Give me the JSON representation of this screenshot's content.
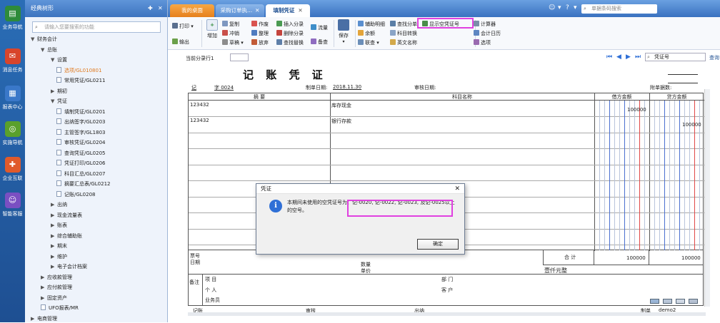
{
  "leftbar": {
    "items": [
      {
        "label": "业务导航",
        "color": "#2e8b3a"
      },
      {
        "label": "消息任务",
        "color": "#d8452b"
      },
      {
        "label": "报表中心",
        "color": "#3a78c9"
      },
      {
        "label": "实施导航",
        "color": "#5aa02c"
      },
      {
        "label": "企业互联",
        "color": "#e05a2b"
      },
      {
        "label": "智能客服",
        "color": "#7a4fc2"
      }
    ]
  },
  "sidebar": {
    "title": "经典树形",
    "search_placeholder": "请输入您要搜索的功能",
    "tree": [
      {
        "label": "财务会计",
        "level": 0,
        "arrow": "▼"
      },
      {
        "label": "总账",
        "level": 1,
        "arrow": "▼"
      },
      {
        "label": "设置",
        "level": 2,
        "arrow": "▼"
      },
      {
        "label": "选项/GL010801",
        "level": 3,
        "doc": true,
        "selected": true
      },
      {
        "label": "常用凭证/GL0211",
        "level": 3,
        "doc": true
      },
      {
        "label": "期初",
        "level": 2,
        "arrow": "▶"
      },
      {
        "label": "凭证",
        "level": 2,
        "arrow": "▼"
      },
      {
        "label": "填制凭证/GL0201",
        "level": 3,
        "doc": true
      },
      {
        "label": "出纳签字/GL0203",
        "level": 3,
        "doc": true
      },
      {
        "label": "主管签字/GL1803",
        "level": 3,
        "doc": true
      },
      {
        "label": "审核凭证/GL0204",
        "level": 3,
        "doc": true
      },
      {
        "label": "查询凭证/GL0205",
        "level": 3,
        "doc": true
      },
      {
        "label": "凭证打印/GL0206",
        "level": 3,
        "doc": true
      },
      {
        "label": "科目汇总/GL0207",
        "level": 3,
        "doc": true
      },
      {
        "label": "摘要汇总表/GL0212",
        "level": 3,
        "doc": true
      },
      {
        "label": "记账/GL0208",
        "level": 3,
        "doc": true
      },
      {
        "label": "出纳",
        "level": 2,
        "arrow": "▶"
      },
      {
        "label": "现金流量表",
        "level": 2,
        "arrow": "▶"
      },
      {
        "label": "账表",
        "level": 2,
        "arrow": "▶"
      },
      {
        "label": "综合辅助账",
        "level": 2,
        "arrow": "▶"
      },
      {
        "label": "期末",
        "level": 2,
        "arrow": "▶"
      },
      {
        "label": "维护",
        "level": 2,
        "arrow": "▶"
      },
      {
        "label": "电子会计档案",
        "level": 2,
        "arrow": "▶"
      },
      {
        "label": "应收款管理",
        "level": 1,
        "arrow": "▶"
      },
      {
        "label": "应付款管理",
        "level": 1,
        "arrow": "▶"
      },
      {
        "label": "固定资产",
        "level": 1,
        "arrow": "▶"
      },
      {
        "label": "UFO报表/MR",
        "level": 1,
        "doc": true
      },
      {
        "label": "电商管理",
        "level": 0,
        "arrow": "▶"
      }
    ]
  },
  "tabs": [
    {
      "label": "我的桌面",
      "active": false,
      "orange": true
    },
    {
      "label": "采购订单执...",
      "active": false
    },
    {
      "label": "填制凭证",
      "active": true
    }
  ],
  "global_search_placeholder": "单据条码搜索",
  "toolbar": {
    "print": "打印",
    "output": "输出",
    "add": "增加",
    "copy": "复制",
    "reverse": "冲销",
    "draft": "草稿",
    "void": "作废",
    "organize": "整理",
    "abandon": "放弃",
    "insert_entry": "插入分录",
    "delete_entry": "删除分录",
    "find_replace": "查找替换",
    "cashflow": "流量",
    "memo": "备查",
    "save": "保存",
    "aux_detail": "辅助明细",
    "balance": "余额",
    "linked_query": "联查",
    "find_entry": "查找分单",
    "subject_convert": "科目转换",
    "english_name": "英文名称",
    "show_empty_voucher": "显示空凭证号",
    "calculator": "计算器",
    "accounting_calendar": "会计日历",
    "options": "选项"
  },
  "nav": {
    "current_entry_label": "当前分录行1",
    "voucher_field_placeholder": "凭证号",
    "query_label": "查询"
  },
  "voucher": {
    "title": "记 账 凭 证",
    "type": "记",
    "number_label": "字 0024",
    "date_label": "制单日期:",
    "date_value": "2018.11.30",
    "audit_date_label": "审核日期:",
    "attachments_label": "附单据数:",
    "headers": {
      "summary": "摘 要",
      "subject": "科目名称",
      "debit": "借方金额",
      "credit": "贷方金额"
    },
    "rows": [
      {
        "summary": "123432",
        "subject": "库存现金",
        "debit": "100000",
        "credit": ""
      },
      {
        "summary": "123432",
        "subject": "银行存款",
        "debit": "",
        "credit": "100000"
      }
    ],
    "ticket_no": "票号",
    "date": "日期",
    "quantity": "数量",
    "unit_price": "单价",
    "total_label": "合 计",
    "total_debit": "100000",
    "total_credit": "100000",
    "total_words": "壹仟元整",
    "remark": "备注",
    "project": "项 目",
    "department": "部 门",
    "person": "个 人",
    "customer": "客 户",
    "salesperson": "业务员",
    "bookkeeping": "记账",
    "audit": "审核",
    "cashier": "出纳",
    "preparer": "制单",
    "preparer_name": "demo2"
  },
  "dialog": {
    "title": "凭证",
    "message_prefix": "本期间未使用的空凭证号为：",
    "message_highlight": "记-0020, 记-0022, 记-0023, 及记-0025以上",
    "message_suffix": "的空号。",
    "ok_label": "确定"
  }
}
